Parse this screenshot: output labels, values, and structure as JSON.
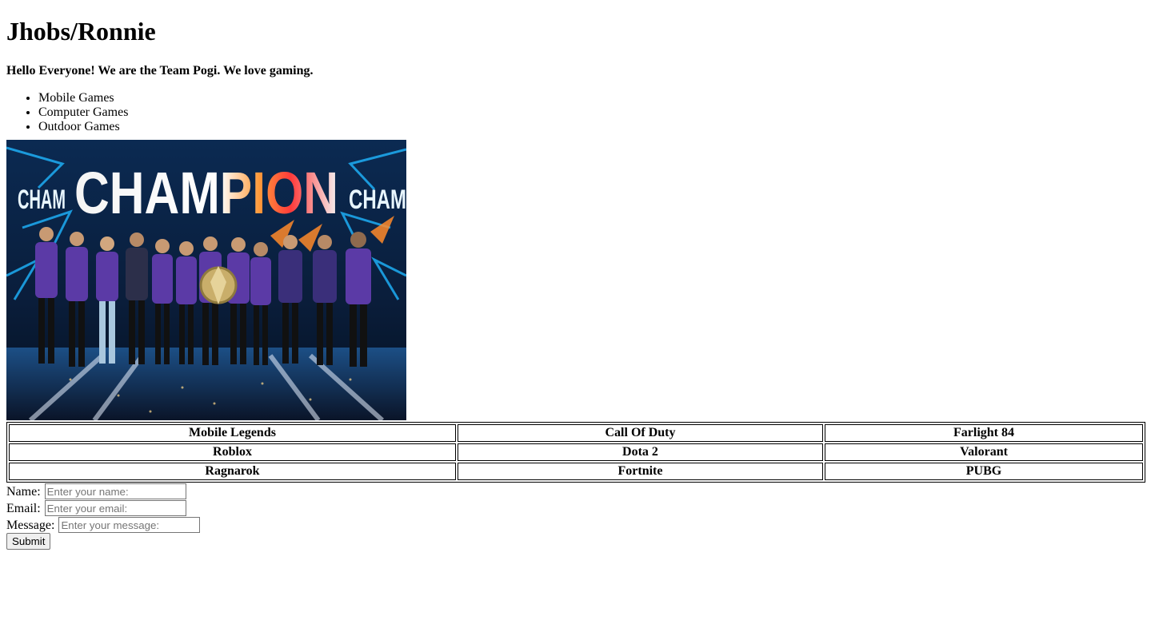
{
  "page": {
    "title": "Jhobs/Ronnie",
    "tagline": "Hello Everyone! We are the Team Pogi. We love gaming."
  },
  "categories": [
    "Mobile Games",
    "Computer Games",
    "Outdoor Games"
  ],
  "photo": {
    "banner_text": "CHAMPION",
    "side_text": "CHAM",
    "colors": {
      "background": "#0a1e3c",
      "jersey": "#5b3aa6",
      "accent_blue": "#1fb6ff",
      "accent_orange": "#ff8a2a",
      "trophy": "#c9ae6a"
    }
  },
  "games_table": [
    [
      "Mobile Legends",
      "Call Of Duty",
      "Farlight 84"
    ],
    [
      "Roblox",
      "Dota 2",
      "Valorant"
    ],
    [
      "Ragnarok",
      "Fortnite",
      "PUBG"
    ]
  ],
  "form": {
    "name_label": "Name:",
    "name_placeholder": "Enter your name:",
    "email_label": "Email:",
    "email_placeholder": "Enter your email:",
    "message_label": "Message:",
    "message_placeholder": "Enter your message:",
    "submit_label": "Submit"
  }
}
